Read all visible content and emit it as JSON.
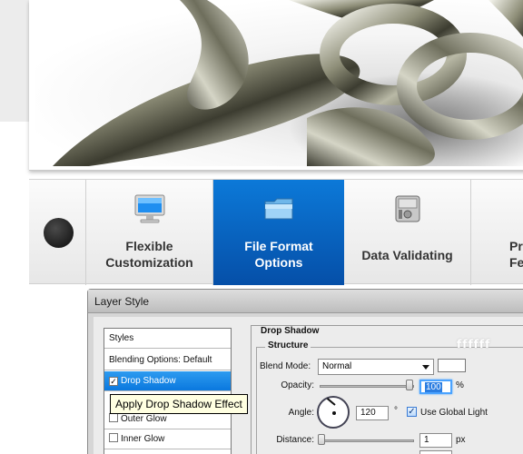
{
  "hero": {
    "image": "chrome-chain-links"
  },
  "tabs": [
    {
      "label_line1": "Flexible",
      "label_line2": "Customization",
      "icon": "monitor-icon"
    },
    {
      "label_line1": "File Format",
      "label_line2": "Options",
      "icon": "folder-icon",
      "active": true
    },
    {
      "label_line1": "Data Validating",
      "label_line2": "",
      "icon": "hard-drive-icon"
    },
    {
      "label_line1": "Pr",
      "label_line2": "Fe",
      "icon": "badge-icon"
    }
  ],
  "dialog": {
    "title": "Layer Style",
    "styles_list": {
      "header": "Styles",
      "blending": "Blending Options: Default",
      "drop_shadow": "Drop Shadow",
      "outer_glow": "Outer Glow",
      "inner_glow": "Inner Glow"
    },
    "tooltip": "Apply Drop Shadow Effect",
    "panel": {
      "title": "Drop Shadow",
      "group_title": "Structure",
      "blend_mode_label": "Blend Mode:",
      "blend_mode_value": "Normal",
      "opacity_label": "Opacity:",
      "opacity_value": "100",
      "opacity_unit": "%",
      "angle_label": "Angle:",
      "angle_value": "120",
      "angle_unit": "°",
      "global_light_label": "Use Global Light",
      "distance_label": "Distance:",
      "distance_value": "1",
      "distance_unit": "px"
    },
    "watermark": "ffffff",
    "colors": {
      "accent": "#0a78de",
      "selection": "#2a7de1"
    }
  }
}
